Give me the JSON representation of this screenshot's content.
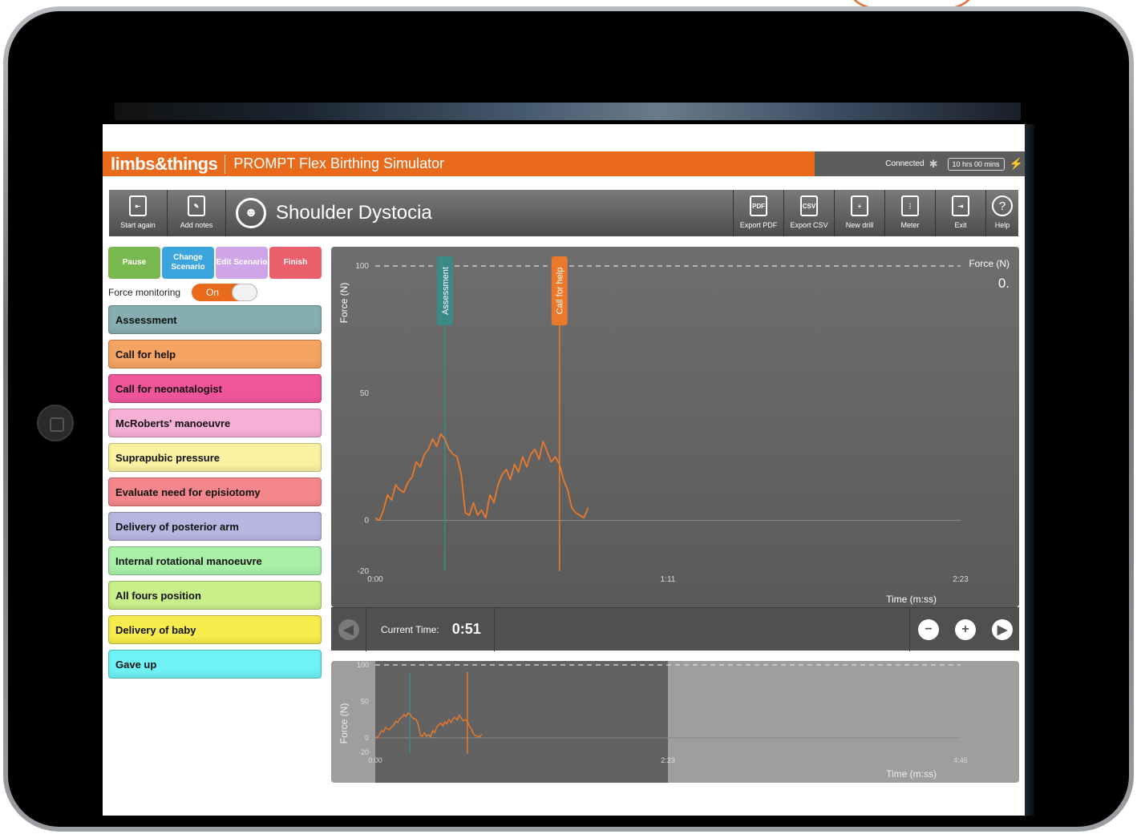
{
  "brand": {
    "logo": "limbs&things",
    "app_title": "PROMPT Flex Birthing Simulator",
    "status": "Connected",
    "battery": "10 hrs 00 mins"
  },
  "toolbar": {
    "start_again": "Start again",
    "add_notes": "Add notes",
    "scenario_title": "Shoulder Dystocia",
    "export_pdf": "Export PDF",
    "export_csv": "Export CSV",
    "new_drill": "New drill",
    "meter": "Meter",
    "exit": "Exit",
    "help": "Help",
    "pdf_badge": "PDF",
    "csv_badge": "CSV"
  },
  "controls": {
    "pause": "Pause",
    "change_scenario": "Change Scenario",
    "edit_scenario": "Edit Scenario",
    "finish": "Finish",
    "force_monitoring": "Force monitoring",
    "toggle_state": "On"
  },
  "events": [
    {
      "label": "Assessment",
      "color": "#86aeb1"
    },
    {
      "label": "Call for help",
      "color": "#f5a462"
    },
    {
      "label": "Call for neonatalogist",
      "color": "#f0559a"
    },
    {
      "label": "McRoberts' manoeuvre",
      "color": "#f6b0d6"
    },
    {
      "label": "Suprapubic pressure",
      "color": "#faf2a0"
    },
    {
      "label": "Evaluate need for episiotomy",
      "color": "#f3878c"
    },
    {
      "label": "Delivery of posterior arm",
      "color": "#b7b6e0"
    },
    {
      "label": "Internal rotational manoeuvre",
      "color": "#a8f0a8"
    },
    {
      "label": "All fours position",
      "color": "#c9ef8a"
    },
    {
      "label": "Delivery of baby",
      "color": "#f6ec4c"
    },
    {
      "label": "Gave up",
      "color": "#6ef2f4"
    }
  ],
  "chart_data": [
    {
      "type": "line",
      "title": "",
      "xlabel": "Time (m:ss)",
      "ylabel": "Force (N)",
      "series": [
        {
          "name": "Force (N)",
          "color": "#ea7a2a"
        }
      ],
      "current_value": "0.",
      "x_ticks": [
        "0:00",
        "1:11",
        "2:23"
      ],
      "y_ticks": [
        100,
        50,
        0,
        -20
      ],
      "xlim_seconds": [
        0,
        143
      ],
      "ylim": [
        -20,
        100
      ],
      "markers": [
        {
          "label": "Assessment",
          "t": 17,
          "color": "#3c8a88"
        },
        {
          "label": "Call for help",
          "t": 45,
          "color": "#ea7a2a"
        }
      ],
      "x": [
        0,
        1,
        2,
        3,
        4,
        5,
        6,
        7,
        8,
        9,
        10,
        11,
        12,
        13,
        14,
        15,
        16,
        17,
        18,
        19,
        20,
        21,
        22,
        23,
        24,
        25,
        26,
        27,
        28,
        29,
        30,
        31,
        32,
        33,
        34,
        35,
        36,
        37,
        38,
        39,
        40,
        41,
        42,
        43,
        44,
        45,
        46,
        47,
        48,
        49,
        50,
        51,
        52
      ],
      "values": [
        1,
        0,
        4,
        10,
        8,
        14,
        12,
        11,
        15,
        17,
        23,
        21,
        26,
        28,
        32,
        29,
        34,
        32,
        28,
        26,
        25,
        18,
        3,
        2,
        7,
        2,
        4,
        1,
        10,
        7,
        14,
        18,
        20,
        16,
        22,
        19,
        25,
        21,
        26,
        28,
        24,
        31,
        27,
        23,
        25,
        22,
        16,
        12,
        5,
        3,
        2,
        1,
        5
      ]
    },
    {
      "type": "line",
      "title": "",
      "xlabel": "Time (m:ss)",
      "ylabel": "Force (N)",
      "series": [
        {
          "name": "Force (N)",
          "color": "#ea7a2a"
        }
      ],
      "x_ticks": [
        "0:00",
        "2:23",
        "4:46"
      ],
      "y_ticks": [
        100,
        50,
        0,
        -20
      ],
      "xlim_seconds": [
        0,
        286
      ],
      "ylim": [
        -20,
        100
      ],
      "window_seconds": [
        0,
        143
      ],
      "markers": [
        {
          "t": 17,
          "color": "#3c8a88"
        },
        {
          "t": 45,
          "color": "#ea7a2a"
        }
      ]
    }
  ],
  "playback": {
    "current_label": "Current Time:",
    "current_time": "0:51"
  }
}
